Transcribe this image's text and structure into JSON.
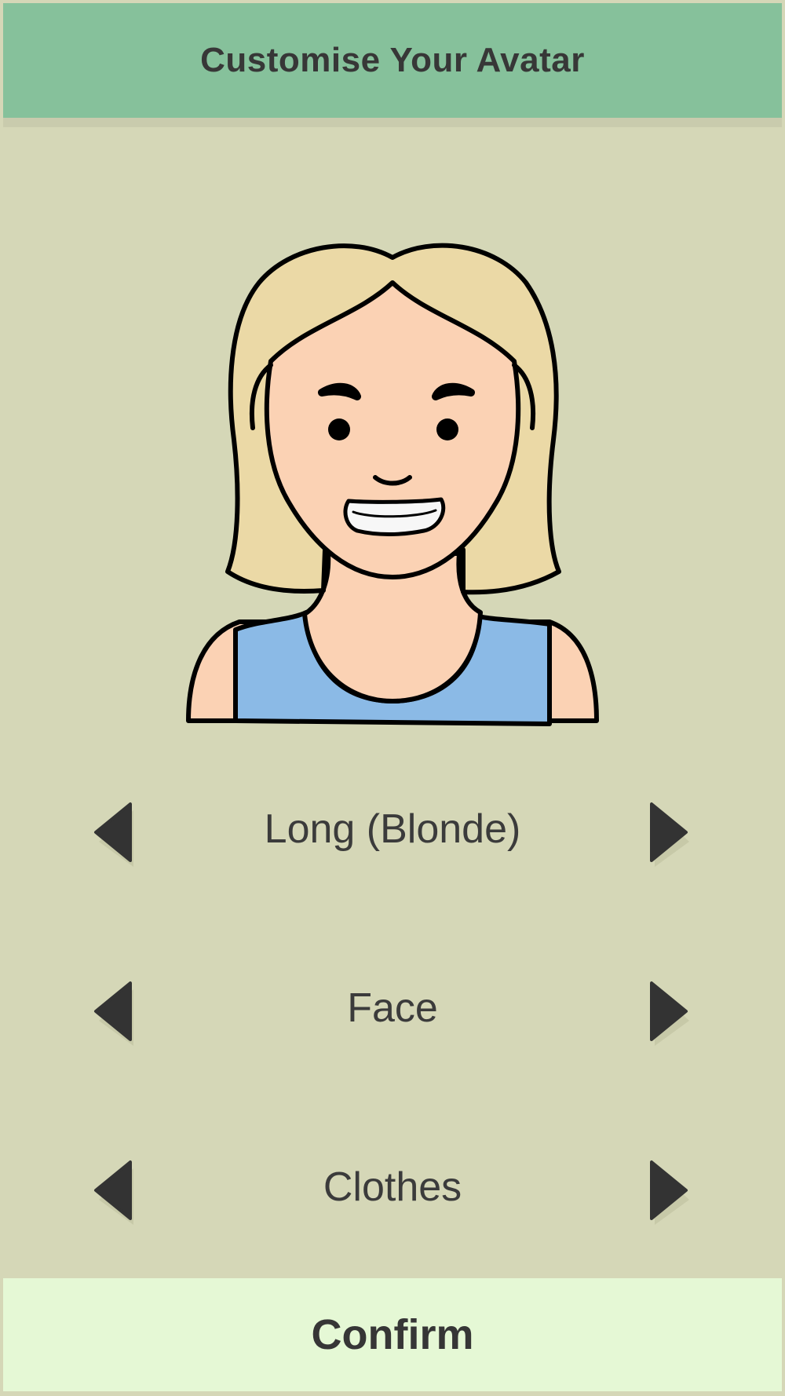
{
  "header": {
    "title": "Customise Your Avatar"
  },
  "avatar": {
    "hair_color": "#ebd9a6",
    "skin_color": "#fbd2b4",
    "shirt_color": "#8bbae6"
  },
  "selectors": [
    {
      "label": "Long (Blonde)",
      "prev_icon": "arrow-left-icon",
      "next_icon": "arrow-right-icon"
    },
    {
      "label": "Face",
      "prev_icon": "arrow-left-icon",
      "next_icon": "arrow-right-icon"
    },
    {
      "label": "Clothes",
      "prev_icon": "arrow-left-icon",
      "next_icon": "arrow-right-icon"
    }
  ],
  "confirm": {
    "label": "Confirm"
  },
  "colors": {
    "background": "#d5d7b7",
    "header": "#86c19b",
    "confirm_bg": "#e5f8d5",
    "text": "#373737"
  }
}
